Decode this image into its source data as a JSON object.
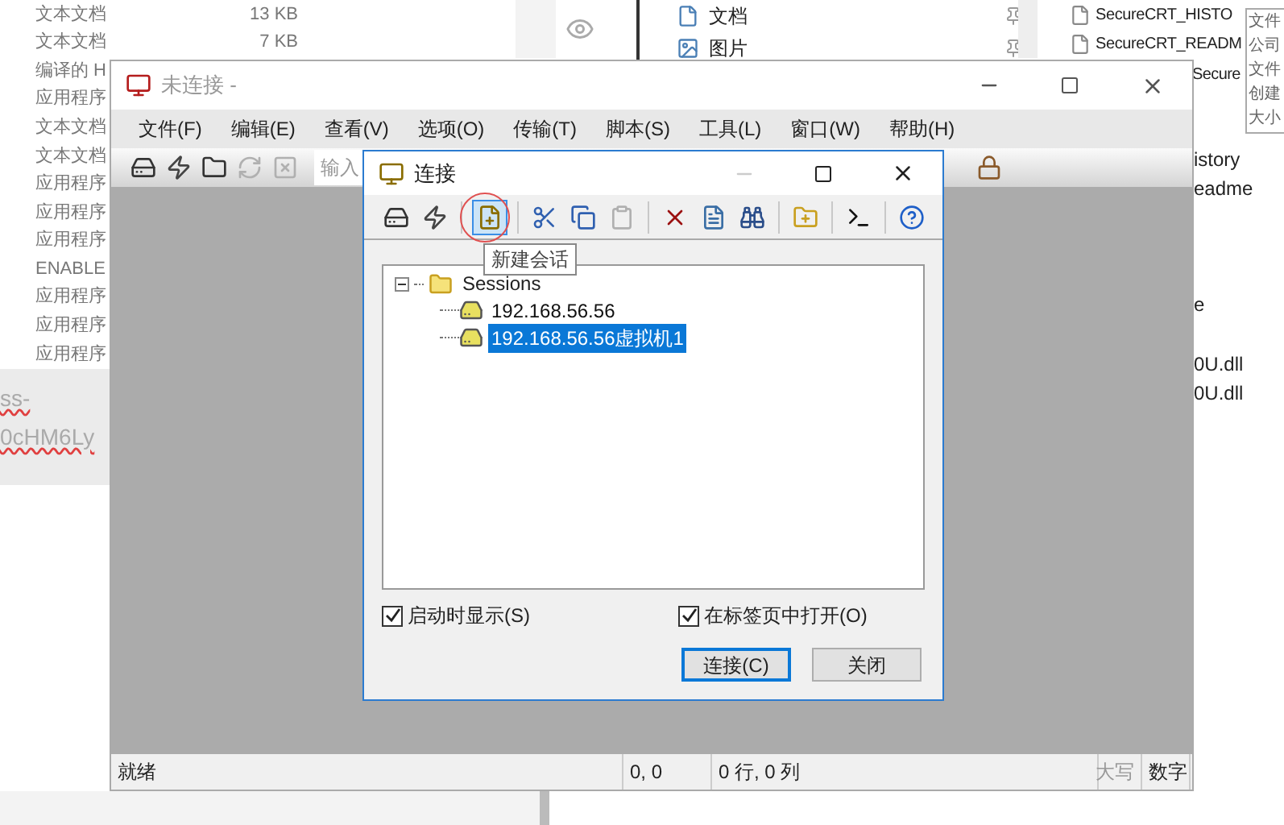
{
  "background": {
    "file_list": [
      {
        "type": "文本文档",
        "size": "13 KB"
      },
      {
        "type": "文本文档",
        "size": "7 KB"
      },
      {
        "type": "编译的 H"
      },
      {
        "type": "应用程序"
      },
      {
        "type": "文本文档"
      },
      {
        "type": "文本文档"
      },
      {
        "type": "应用程序"
      },
      {
        "type": "应用程序"
      },
      {
        "type": "应用程序"
      },
      {
        "type": "ENABLE"
      },
      {
        "type": "应用程序"
      },
      {
        "type": "应用程序"
      },
      {
        "type": "应用程序"
      }
    ],
    "editor_lines": [
      "ss-",
      "0cHM6Ly"
    ],
    "nav_items": [
      {
        "label": "文档",
        "kind": "document"
      },
      {
        "label": "图片",
        "kind": "image"
      }
    ],
    "files": [
      "SecureCRT_HISTO",
      "SecureCRT_READM"
    ],
    "file_cut": "Secure",
    "file_fragments": [
      {
        "text": "istory"
      },
      {
        "text": "eadme"
      },
      {
        "text": "e"
      },
      {
        "text": "0U.dll"
      },
      {
        "text": "0U.dll"
      }
    ],
    "tooltip_lines": [
      "文件",
      "公司",
      "文件",
      "创建",
      "大小"
    ]
  },
  "main_window": {
    "title": "未连接 -",
    "menu": [
      "文件(F)",
      "编辑(E)",
      "查看(V)",
      "选项(O)",
      "传输(T)",
      "脚本(S)",
      "工具(L)",
      "窗口(W)",
      "帮助(H)"
    ],
    "toolbar": [
      {
        "kind": "connect",
        "disabled": false
      },
      {
        "kind": "quick_connect",
        "disabled": false
      },
      {
        "kind": "connect_tab",
        "disabled": false
      },
      {
        "kind": "reconnect",
        "disabled": true
      },
      {
        "kind": "disconnect",
        "disabled": true
      }
    ],
    "host_field": {
      "placeholder": "输入"
    },
    "status_bar": [
      {
        "text": "就绪",
        "disabled": false
      },
      {
        "text": "0, 0",
        "disabled": false
      },
      {
        "text": "0 行, 0 列",
        "disabled": false
      },
      {
        "text": "大写",
        "disabled": true
      },
      {
        "text": "数字",
        "disabled": false
      }
    ]
  },
  "dialog": {
    "title": "连接",
    "toolbar": [
      {
        "kind": "connect",
        "disabled": false,
        "pressed": false
      },
      {
        "kind": "quick_connect",
        "disabled": false,
        "pressed": false
      },
      {
        "kind": "separator"
      },
      {
        "kind": "new_session",
        "disabled": false,
        "pressed": true
      },
      {
        "kind": "separator"
      },
      {
        "kind": "cut",
        "disabled": false,
        "pressed": false
      },
      {
        "kind": "copy",
        "disabled": false,
        "pressed": false
      },
      {
        "kind": "paste",
        "disabled": true,
        "pressed": false
      },
      {
        "kind": "separator"
      },
      {
        "kind": "delete",
        "disabled": false,
        "pressed": false
      },
      {
        "kind": "properties",
        "disabled": false,
        "pressed": false
      },
      {
        "kind": "find",
        "disabled": false,
        "pressed": false
      },
      {
        "kind": "separator"
      },
      {
        "kind": "new_folder",
        "disabled": false,
        "pressed": false
      },
      {
        "kind": "separator"
      },
      {
        "kind": "terminal",
        "disabled": false,
        "pressed": false
      },
      {
        "kind": "separator"
      },
      {
        "kind": "help",
        "disabled": false,
        "pressed": false
      }
    ],
    "tooltip": "新建会话",
    "tree": {
      "label": "Sessions",
      "expanded": true,
      "children": [
        {
          "label": "192.168.56.56",
          "selected": false
        },
        {
          "label": "192.168.56.56虚拟机1",
          "selected": true
        }
      ]
    },
    "checkboxes": [
      {
        "label": "启动时显示(S)",
        "checked": true
      },
      {
        "label": "在标签页中打开(O)",
        "checked": true
      }
    ],
    "buttons": [
      {
        "label": "连接(C)",
        "default": true
      },
      {
        "label": "关闭",
        "default": false
      }
    ]
  }
}
